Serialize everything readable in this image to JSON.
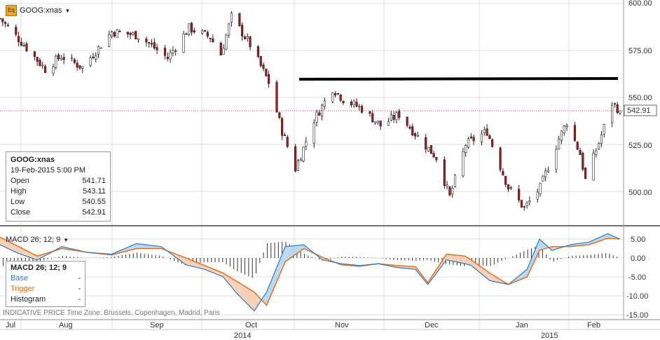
{
  "header": {
    "icon_label": "Eq",
    "symbol": "GOOG:xnas",
    "dropdown_glyph": "▼"
  },
  "price_panel": {
    "y_ticks": [
      "600.00",
      "575.00",
      "550.00",
      "525.00",
      "500.00"
    ],
    "last_price_tag": "542.91",
    "resistance_level": 560
  },
  "info_box": {
    "symbol": "GOOG:xnas",
    "datetime": "19-Feb-2015 5:00 PM",
    "rows": [
      {
        "label": "Open",
        "value": "541.71"
      },
      {
        "label": "High",
        "value": "543.11"
      },
      {
        "label": "Low",
        "value": "540.55"
      },
      {
        "label": "Close",
        "value": "542.91"
      }
    ]
  },
  "macd_panel": {
    "title": "MACD 26; 12; 9",
    "dropdown_glyph": "▼",
    "y_ticks": [
      "5.00",
      "0.00",
      "-5.00",
      "-10.00",
      "-15.00"
    ],
    "legend": [
      {
        "label": "Base",
        "value": "-",
        "color": "#2b7bbf"
      },
      {
        "label": "Trigger",
        "value": "-",
        "color": "#e07020"
      },
      {
        "label": "Histogram",
        "value": "-",
        "color": "#333333"
      }
    ]
  },
  "footer_note": "INDICATIVE PRICE   Time Zone: Brussels, Copenhagen, Madrid, Paris",
  "x_axis": {
    "months": [
      "Jul",
      "Aug",
      "Sep",
      "Oct",
      "Nov",
      "Dec",
      "Jan",
      "Feb"
    ],
    "years": [
      "2014",
      "2015"
    ]
  },
  "colors": {
    "up_candle": "#ffffff",
    "down_candle": "#b01818",
    "base_line": "#2b7bbf",
    "trigger_line": "#e07020",
    "fill_up": "#bcd8f0",
    "fill_down": "#f8d0b8",
    "grid": "#dcdcdc",
    "last_price_line": "#b01818"
  },
  "chart_data": [
    {
      "type": "candlestick",
      "title": "GOOG:xnas",
      "x_range": [
        "2014-07-01",
        "2015-02-19"
      ],
      "ylim": [
        480,
        600
      ],
      "close_path": [
        {
          "date": "2014-07-01",
          "close": 592
        },
        {
          "date": "2014-07-10",
          "close": 578
        },
        {
          "date": "2014-07-18",
          "close": 565
        },
        {
          "date": "2014-07-24",
          "close": 572
        },
        {
          "date": "2014-08-01",
          "close": 566
        },
        {
          "date": "2014-08-12",
          "close": 585
        },
        {
          "date": "2014-08-22",
          "close": 583
        },
        {
          "date": "2014-09-02",
          "close": 571
        },
        {
          "date": "2014-09-10",
          "close": 587
        },
        {
          "date": "2014-09-18",
          "close": 582
        },
        {
          "date": "2014-09-22",
          "close": 573
        },
        {
          "date": "2014-09-26",
          "close": 593
        },
        {
          "date": "2014-10-03",
          "close": 578
        },
        {
          "date": "2014-10-10",
          "close": 558
        },
        {
          "date": "2014-10-15",
          "close": 532
        },
        {
          "date": "2014-10-20",
          "close": 512
        },
        {
          "date": "2014-10-27",
          "close": 538
        },
        {
          "date": "2014-11-03",
          "close": 555
        },
        {
          "date": "2014-11-07",
          "close": 549
        },
        {
          "date": "2014-11-14",
          "close": 544
        },
        {
          "date": "2014-11-21",
          "close": 535
        },
        {
          "date": "2014-11-28",
          "close": 541
        },
        {
          "date": "2014-12-05",
          "close": 529
        },
        {
          "date": "2014-12-12",
          "close": 518
        },
        {
          "date": "2014-12-17",
          "close": 497
        },
        {
          "date": "2014-12-23",
          "close": 525
        },
        {
          "date": "2014-12-31",
          "close": 532
        },
        {
          "date": "2015-01-08",
          "close": 502
        },
        {
          "date": "2015-01-14",
          "close": 491
        },
        {
          "date": "2015-01-20",
          "close": 502
        },
        {
          "date": "2015-01-27",
          "close": 528
        },
        {
          "date": "2015-01-30",
          "close": 537
        },
        {
          "date": "2015-02-04",
          "close": 520
        },
        {
          "date": "2015-02-06",
          "close": 506
        },
        {
          "date": "2015-02-12",
          "close": 530
        },
        {
          "date": "2015-02-16",
          "close": 547
        },
        {
          "date": "2015-02-19",
          "close": 542.91
        }
      ],
      "last_bar": {
        "date": "2015-02-19",
        "open": 541.71,
        "high": 543.11,
        "low": 540.55,
        "close": 542.91
      }
    },
    {
      "type": "line",
      "title": "MACD 26; 12; 9",
      "ylim": [
        -15,
        7
      ],
      "series": [
        {
          "name": "Base",
          "points": [
            [
              0,
              3.5
            ],
            [
              0.03,
              1.2
            ],
            [
              0.06,
              -0.5
            ],
            [
              0.1,
              3
            ],
            [
              0.14,
              1.5
            ],
            [
              0.18,
              1
            ],
            [
              0.22,
              3.8
            ],
            [
              0.26,
              3
            ],
            [
              0.3,
              -1.8
            ],
            [
              0.33,
              -3
            ],
            [
              0.36,
              -5
            ],
            [
              0.38,
              -9
            ],
            [
              0.41,
              -14
            ],
            [
              0.43,
              -9
            ],
            [
              0.46,
              3
            ],
            [
              0.49,
              3.5
            ],
            [
              0.52,
              -0.5
            ],
            [
              0.55,
              -1.5
            ],
            [
              0.58,
              -2
            ],
            [
              0.61,
              -1.5
            ],
            [
              0.64,
              -2.5
            ],
            [
              0.67,
              -3
            ],
            [
              0.69,
              -7
            ],
            [
              0.72,
              -0.5
            ],
            [
              0.75,
              -1.5
            ],
            [
              0.76,
              -2
            ],
            [
              0.79,
              -6
            ],
            [
              0.82,
              -7
            ],
            [
              0.85,
              -3
            ],
            [
              0.87,
              5
            ],
            [
              0.89,
              2
            ],
            [
              0.92,
              3.5
            ],
            [
              0.95,
              4.2
            ],
            [
              0.98,
              6.4
            ],
            [
              1,
              5
            ]
          ]
        },
        {
          "name": "Trigger",
          "points": [
            [
              0,
              5.5
            ],
            [
              0.03,
              3
            ],
            [
              0.06,
              0.5
            ],
            [
              0.1,
              2.5
            ],
            [
              0.14,
              1.5
            ],
            [
              0.18,
              0.8
            ],
            [
              0.22,
              2.5
            ],
            [
              0.26,
              2.5
            ],
            [
              0.3,
              0
            ],
            [
              0.33,
              -2
            ],
            [
              0.36,
              -4
            ],
            [
              0.38,
              -6
            ],
            [
              0.41,
              -9
            ],
            [
              0.43,
              -12.5
            ],
            [
              0.46,
              -1
            ],
            [
              0.49,
              2.5
            ],
            [
              0.52,
              0.2
            ],
            [
              0.55,
              -1.8
            ],
            [
              0.58,
              -2.2
            ],
            [
              0.61,
              -1.5
            ],
            [
              0.64,
              -2
            ],
            [
              0.67,
              -2.3
            ],
            [
              0.69,
              -6.5
            ],
            [
              0.72,
              1
            ],
            [
              0.75,
              0.5
            ],
            [
              0.76,
              -0.5
            ],
            [
              0.79,
              -4
            ],
            [
              0.82,
              -7
            ],
            [
              0.85,
              -5
            ],
            [
              0.87,
              2
            ],
            [
              0.89,
              3
            ],
            [
              0.92,
              3
            ],
            [
              0.95,
              3.5
            ],
            [
              0.98,
              5.2
            ],
            [
              1,
              5
            ]
          ]
        }
      ]
    }
  ]
}
